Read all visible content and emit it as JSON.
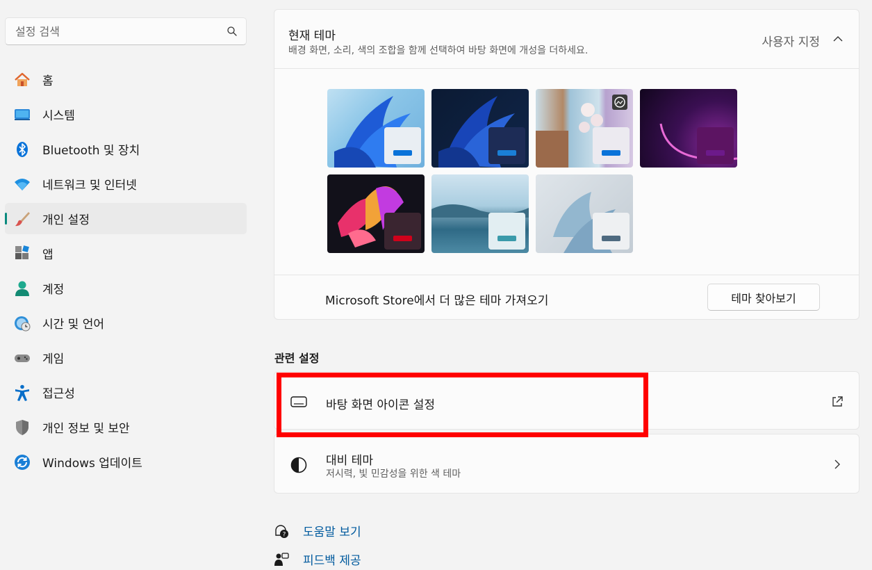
{
  "search": {
    "placeholder": "설정 검색"
  },
  "sidebar": {
    "items": [
      {
        "label": "홈",
        "icon": "home-icon"
      },
      {
        "label": "시스템",
        "icon": "system-icon"
      },
      {
        "label": "Bluetooth 및 장치",
        "icon": "bluetooth-icon"
      },
      {
        "label": "네트워크 및 인터넷",
        "icon": "wifi-icon"
      },
      {
        "label": "개인 설정",
        "icon": "brush-icon",
        "active": true
      },
      {
        "label": "앱",
        "icon": "apps-icon"
      },
      {
        "label": "계정",
        "icon": "account-icon"
      },
      {
        "label": "시간 및 언어",
        "icon": "time-language-icon"
      },
      {
        "label": "게임",
        "icon": "gamepad-icon"
      },
      {
        "label": "접근성",
        "icon": "accessibility-icon"
      },
      {
        "label": "개인 정보 및 보안",
        "icon": "shield-icon"
      },
      {
        "label": "Windows 업데이트",
        "icon": "update-icon"
      }
    ]
  },
  "theme": {
    "title": "현재 테마",
    "subtitle": "배경 화면, 소리, 색의 조합을 함께 선택하여 바탕 화면에 개성을 더하세요.",
    "status": "사용자 지정",
    "store_text": "Microsoft Store에서 더 많은 테마 가져오기",
    "browse_label": "테마 찾아보기"
  },
  "related": {
    "title": "관련 설정",
    "desktop_icons_label": "바탕 화면 아이콘 설정",
    "contrast_label": "대비 테마",
    "contrast_sub": "저시력, 빛 민감성을 위한 색 테마"
  },
  "links": {
    "help": "도움말 보기",
    "feedback": "피드백 제공"
  },
  "colors": {
    "accent": "#0067c0",
    "active_indicator": "#0a8a7e",
    "highlight": "#ff0000",
    "link": "#005a9e"
  }
}
